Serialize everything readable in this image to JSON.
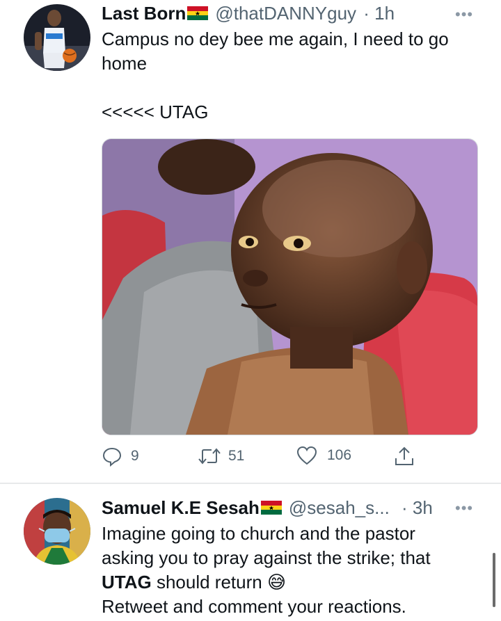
{
  "tweets": [
    {
      "name": "Last Born",
      "handle": "@thatDANNYguy",
      "time": "· 1h",
      "text_line1": "Campus no dey bee me again, I need to go",
      "text_line2": "home",
      "text_line3": "<<<<< UTAG",
      "avatar": "basketball-player-avatar",
      "media": "meme-photo-boy-looking-sideways",
      "replies": "9",
      "retweets": "51",
      "likes": "106"
    },
    {
      "name": "Samuel K.E Sesah",
      "handle": "@sesah_s...",
      "time": "· 3h",
      "text_line1": "Imagine going to church and the pastor",
      "text_line2": "asking you to pray against the strike; that",
      "text_bold": "UTAG",
      "text_line3_rest": " should return ",
      "emoji": "😅",
      "text_line4": "Retweet and comment your reactions.",
      "avatar": "man-with-face-mask-avatar"
    }
  ],
  "more_glyph": "•••",
  "icons": {
    "reply": "reply-icon",
    "retweet": "retweet-icon",
    "like": "heart-icon",
    "share": "share-icon",
    "flag": "ghana-flag-icon",
    "more": "more-options-icon"
  },
  "colors": {
    "text": "#0f1419",
    "secondary": "#536471",
    "divider": "#e7e9ea"
  }
}
